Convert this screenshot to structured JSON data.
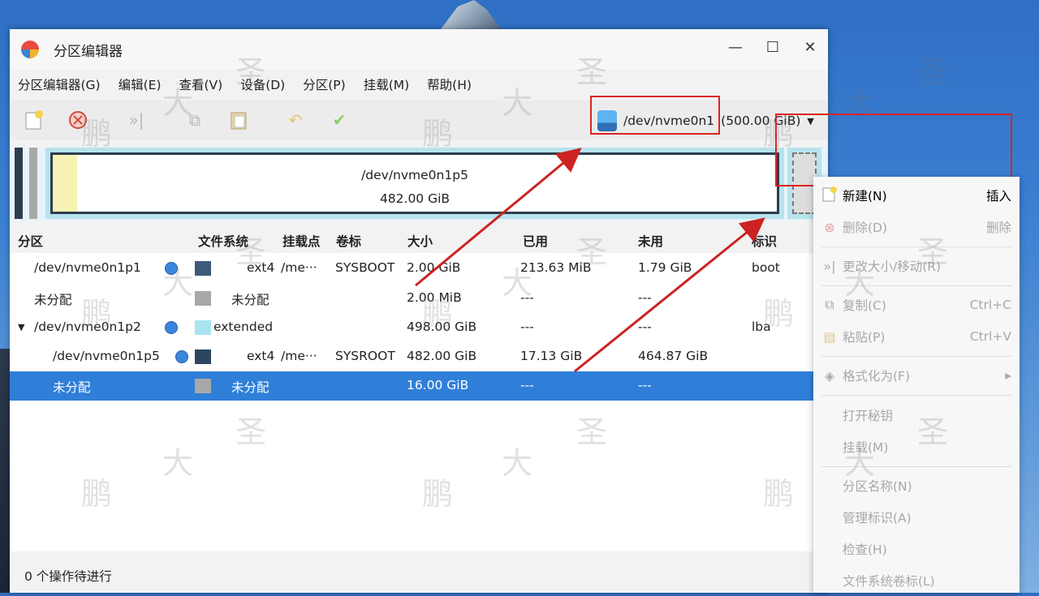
{
  "window": {
    "title": "分区编辑器",
    "buttons": {
      "minimize": "—",
      "maximize": "☐",
      "close": "✕"
    }
  },
  "menubar": [
    "分区编辑器(G)",
    "编辑(E)",
    "查看(V)",
    "设备(D)",
    "分区(P)",
    "挂载(M)",
    "帮助(H)"
  ],
  "toolbar": {
    "icons": [
      "new-icon",
      "delete-icon",
      "resize-icon",
      "copy-icon",
      "paste-icon",
      "undo-icon",
      "apply-icon"
    ],
    "device_name": "/dev/nvme0n1",
    "device_size": "(500.00 GiB)",
    "dropdown_arrow": "▼"
  },
  "diskmap": {
    "partition_name": "/dev/nvme0n1p5",
    "partition_size": "482.00 GiB"
  },
  "table": {
    "headers": [
      "分区",
      "文件系统",
      "挂载点",
      "卷标",
      "大小",
      "已用",
      "未用",
      "标识"
    ],
    "rows": [
      {
        "name": "/dev/nvme0n1p1",
        "fs": "ext4",
        "mount": "/me···",
        "label": "SYSBOOT",
        "size": "2.00 GiB",
        "used": "213.63 MiB",
        "unused": "1.79 GiB",
        "flags": "boot",
        "color": "#3d5a7a"
      },
      {
        "name": "未分配",
        "fs": "未分配",
        "mount": "",
        "label": "",
        "size": "2.00 MiB",
        "used": "---",
        "unused": "---",
        "flags": "",
        "color": "#a8a8a8"
      },
      {
        "name": "/dev/nvme0n1p2",
        "fs": "extended",
        "mount": "",
        "label": "",
        "size": "498.00 GiB",
        "used": "---",
        "unused": "---",
        "flags": "lba",
        "color": "#a8e4ee",
        "expander": "▼"
      },
      {
        "name": "/dev/nvme0n1p5",
        "fs": "ext4",
        "mount": "/me···",
        "label": "SYSROOT",
        "size": "482.00 GiB",
        "used": "17.13 GiB",
        "unused": "464.87 GiB",
        "flags": "",
        "color": "#2e4460"
      },
      {
        "name": "未分配",
        "fs": "未分配",
        "mount": "",
        "label": "",
        "size": "16.00 GiB",
        "used": "---",
        "unused": "---",
        "flags": "",
        "color": "#a8a8a8"
      }
    ]
  },
  "status": "0 个操作待进行",
  "context_menu": [
    {
      "label": "新建(N)",
      "accel": "插入",
      "enabled": true,
      "icon": "new-icon"
    },
    {
      "label": "删除(D)",
      "accel": "删除",
      "enabled": false,
      "icon": "delete-icon"
    },
    {
      "label": "更改大小/移动(R)",
      "accel": "",
      "enabled": false,
      "icon": "resize-icon"
    },
    {
      "label": "复制(C)",
      "accel": "Ctrl+C",
      "enabled": false,
      "icon": "copy-icon"
    },
    {
      "label": "粘贴(P)",
      "accel": "Ctrl+V",
      "enabled": false,
      "icon": "paste-icon"
    },
    {
      "label": "格式化为(F)",
      "accel": "▸",
      "enabled": false,
      "icon": "format-icon"
    },
    {
      "label": "打开秘钥",
      "accel": "",
      "enabled": false,
      "icon": ""
    },
    {
      "label": "挂载(M)",
      "accel": "",
      "enabled": false,
      "icon": ""
    },
    {
      "label": "分区名称(N)",
      "accel": "",
      "enabled": false,
      "icon": ""
    },
    {
      "label": "管理标识(A)",
      "accel": "",
      "enabled": false,
      "icon": ""
    },
    {
      "label": "检查(H)",
      "accel": "",
      "enabled": false,
      "icon": ""
    },
    {
      "label": "文件系统卷标(L)",
      "accel": "",
      "enabled": false,
      "icon": ""
    }
  ],
  "watermark": [
    "鹏",
    "大",
    "圣"
  ],
  "colors": {
    "selection": "#2f7fd8",
    "highlight_box": "#dd2222"
  }
}
